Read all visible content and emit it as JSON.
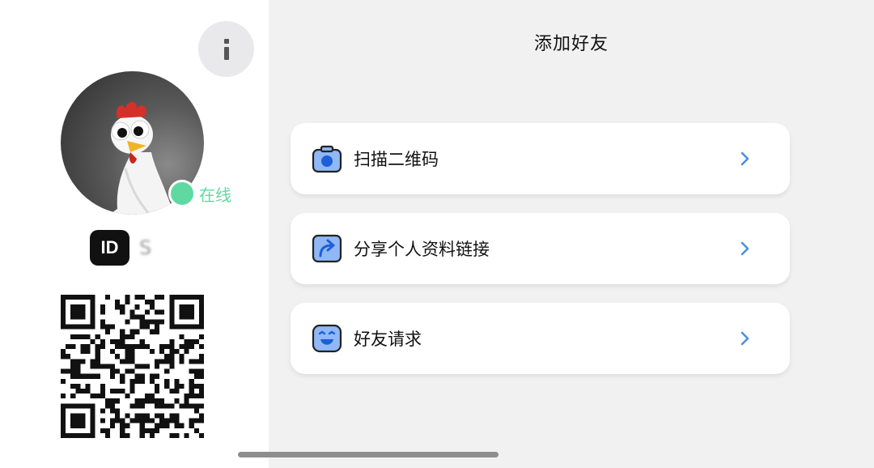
{
  "profile": {
    "info_icon": "info-icon",
    "status_label": "在线",
    "status_color": "#5fd9a2",
    "id_badge": "ID",
    "id_value": "S"
  },
  "add_friend": {
    "title": "添加好友",
    "items": [
      {
        "label": "扫描二维码",
        "icon": "camera-icon"
      },
      {
        "label": "分享个人资料链接",
        "icon": "share-icon"
      },
      {
        "label": "好友请求",
        "icon": "smiley-icon"
      }
    ]
  },
  "colors": {
    "accent": "#4a90e2",
    "icon_fill": "#8fb8f5"
  }
}
